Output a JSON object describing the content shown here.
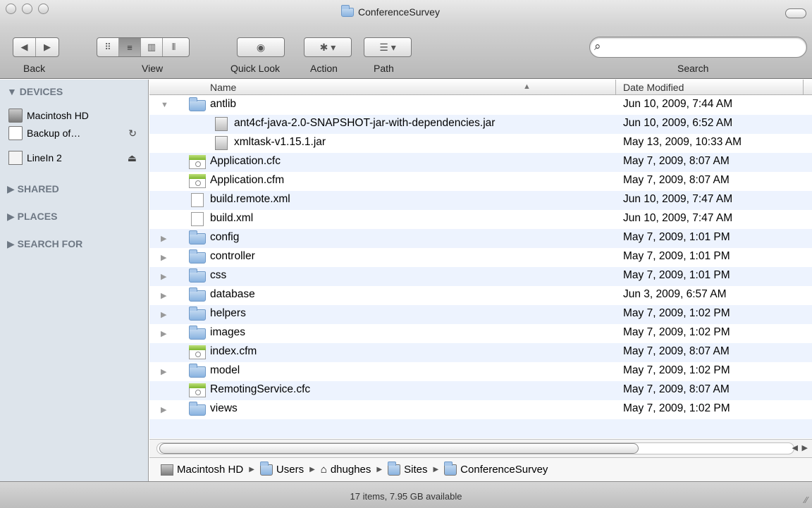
{
  "window": {
    "title": "ConferenceSurvey"
  },
  "toolbar": {
    "back_label": "Back",
    "view_label": "View",
    "quicklook_label": "Quick Look",
    "action_label": "Action",
    "path_label": "Path",
    "search_label": "Search",
    "search_value": "",
    "view_selected": "list"
  },
  "sidebar": {
    "devices_header": "▼ DEVICES",
    "devices": [
      {
        "label": "Macintosh HD",
        "icon": "hard-drive-icon"
      },
      {
        "label": "Backup of…",
        "icon": "disk-icon",
        "action": "↻"
      },
      {
        "label": "LineIn 2",
        "icon": "app-icon",
        "action": "⏏"
      }
    ],
    "shared_header": "▶ SHARED",
    "places_header": "▶ PLACES",
    "search_header": "▶ SEARCH FOR"
  },
  "columns": {
    "name": "Name",
    "date": "Date Modified"
  },
  "files": [
    {
      "name": "antlib",
      "date": "Jun 10, 2009, 7:44 AM",
      "type": "folder",
      "expanded": true,
      "level": 0
    },
    {
      "name": "ant4cf-java-2.0-SNAPSHOT-jar-with-dependencies.jar",
      "date": "Jun 10, 2009, 6:52 AM",
      "type": "jar",
      "level": 1
    },
    {
      "name": "xmltask-v1.15.1.jar",
      "date": "May 13, 2009, 10:33 AM",
      "type": "jar",
      "level": 1
    },
    {
      "name": "Application.cfc",
      "date": "May 7, 2009, 8:07 AM",
      "type": "cf",
      "level": 0
    },
    {
      "name": "Application.cfm",
      "date": "May 7, 2009, 8:07 AM",
      "type": "cf",
      "level": 0
    },
    {
      "name": "build.remote.xml",
      "date": "Jun 10, 2009, 7:47 AM",
      "type": "doc",
      "level": 0
    },
    {
      "name": "build.xml",
      "date": "Jun 10, 2009, 7:47 AM",
      "type": "doc",
      "level": 0
    },
    {
      "name": "config",
      "date": "May 7, 2009, 1:01 PM",
      "type": "folder",
      "level": 0
    },
    {
      "name": "controller",
      "date": "May 7, 2009, 1:01 PM",
      "type": "folder",
      "level": 0
    },
    {
      "name": "css",
      "date": "May 7, 2009, 1:01 PM",
      "type": "folder",
      "level": 0
    },
    {
      "name": "database",
      "date": "Jun 3, 2009, 6:57 AM",
      "type": "folder",
      "level": 0
    },
    {
      "name": "helpers",
      "date": "May 7, 2009, 1:02 PM",
      "type": "folder",
      "level": 0
    },
    {
      "name": "images",
      "date": "May 7, 2009, 1:02 PM",
      "type": "folder",
      "level": 0
    },
    {
      "name": "index.cfm",
      "date": "May 7, 2009, 8:07 AM",
      "type": "cf",
      "level": 0
    },
    {
      "name": "model",
      "date": "May 7, 2009, 1:02 PM",
      "type": "folder",
      "level": 0
    },
    {
      "name": "RemotingService.cfc",
      "date": "May 7, 2009, 8:07 AM",
      "type": "cf",
      "level": 0
    },
    {
      "name": "views",
      "date": "May 7, 2009, 1:02 PM",
      "type": "folder",
      "level": 0
    }
  ],
  "path": [
    {
      "label": "Macintosh HD",
      "icon": "hard-drive-icon"
    },
    {
      "label": "Users",
      "icon": "users-folder-icon"
    },
    {
      "label": "dhughes",
      "icon": "home-icon"
    },
    {
      "label": "Sites",
      "icon": "sites-folder-icon"
    },
    {
      "label": "ConferenceSurvey",
      "icon": "folder-icon"
    }
  ],
  "status": {
    "text": "17 items, 7.95 GB available"
  }
}
